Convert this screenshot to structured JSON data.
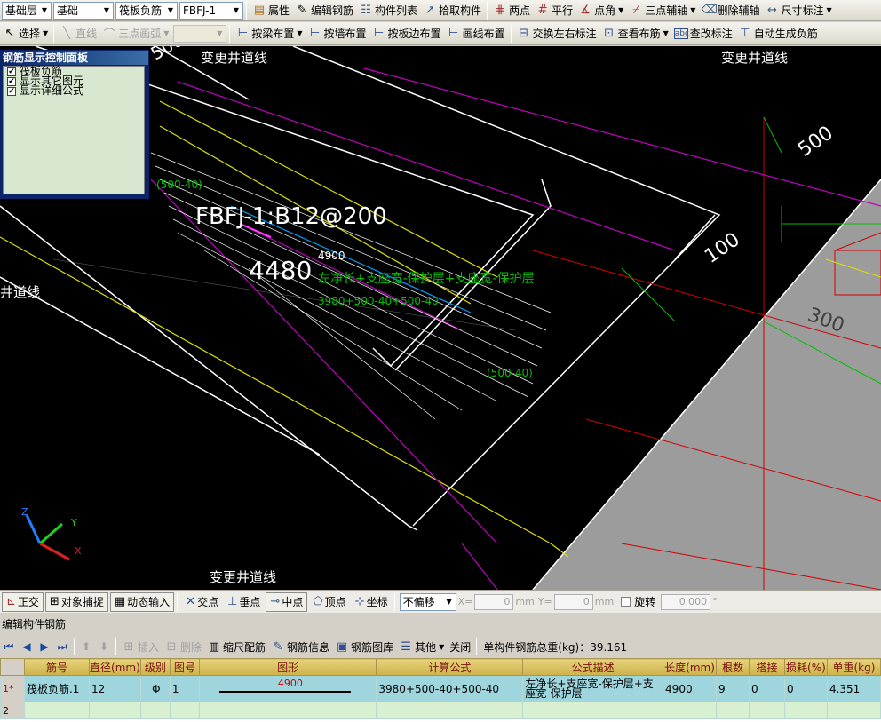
{
  "toolbar1": {
    "floor": "基础层",
    "category": "基础",
    "type": "筏板负筋",
    "element": "FBFJ-1",
    "buttons": [
      "属性",
      "编辑钢筋",
      "构件列表",
      "拾取构件",
      "两点",
      "平行",
      "点角",
      "三点辅轴",
      "删除辅轴",
      "尺寸标注"
    ]
  },
  "toolbar2": {
    "select": "选择",
    "line": "直线",
    "arc": "三点画弧",
    "buttons": [
      "按梁布置",
      "按墙布置",
      "按板边布置",
      "画线布置",
      "交换左右标注",
      "查看布筋",
      "查改标注",
      "自动生成负筋"
    ]
  },
  "panel": {
    "title": "钢筋显示控制面板",
    "options": [
      "筏板负筋",
      "显示其它图元",
      "显示详细公式"
    ]
  },
  "viewport": {
    "axis_labels": [
      "变更井道线",
      "变更井道线",
      "井道线",
      "变更井道线"
    ],
    "dims": [
      "500",
      "100",
      "300",
      "500"
    ],
    "rebar_label": "FBFJ-1:B12@200",
    "len_total": "4480",
    "len_small": "4900",
    "formula_desc": "左净长+支座宽-保护层+支座宽-保护层",
    "formula": "3980+500-40+500-40",
    "annot1": "(500-40)",
    "annot2": "(500-40)"
  },
  "statusbar": {
    "buttons": [
      "正交",
      "对象捕捉",
      "动态输入",
      "交点",
      "垂点",
      "中点",
      "顶点",
      "坐标"
    ],
    "offset": "不偏移",
    "x_label": "X=",
    "x_val": "0",
    "y_label": "Y=",
    "y_val": "0",
    "unit": "mm",
    "rotate": "旋转",
    "rotate_val": "0.000",
    "deg": "°"
  },
  "editor": {
    "title": "编辑构件钢筋",
    "buttons": [
      "插入",
      "删除",
      "缩尺配筋",
      "钢筋信息",
      "钢筋图库",
      "其他",
      "关闭"
    ],
    "total": "单构件钢筋总重(kg)：39.161"
  },
  "grid": {
    "headers": [
      "筋号",
      "直径(mm)",
      "级别",
      "图号",
      "图形",
      "计算公式",
      "公式描述",
      "长度(mm)",
      "根数",
      "搭接",
      "损耗(%)",
      "单重(kg)"
    ],
    "rows": [
      {
        "idx": "1*",
        "name": "筏板负筋.1",
        "dia": "12",
        "grade": "Φ",
        "fig": "1",
        "shape": "4900",
        "formula": "3980+500-40+500-40",
        "desc": "左净长+支座宽-保护层+支座宽-保护层",
        "len": "4900",
        "count": "9",
        "lap": "0",
        "loss": "0",
        "weight": "4.351"
      },
      {
        "idx": "2",
        "name": "",
        "dia": "",
        "grade": "",
        "fig": "",
        "shape": "",
        "formula": "",
        "desc": "",
        "len": "",
        "count": "",
        "lap": "",
        "loss": "",
        "weight": ""
      }
    ]
  }
}
